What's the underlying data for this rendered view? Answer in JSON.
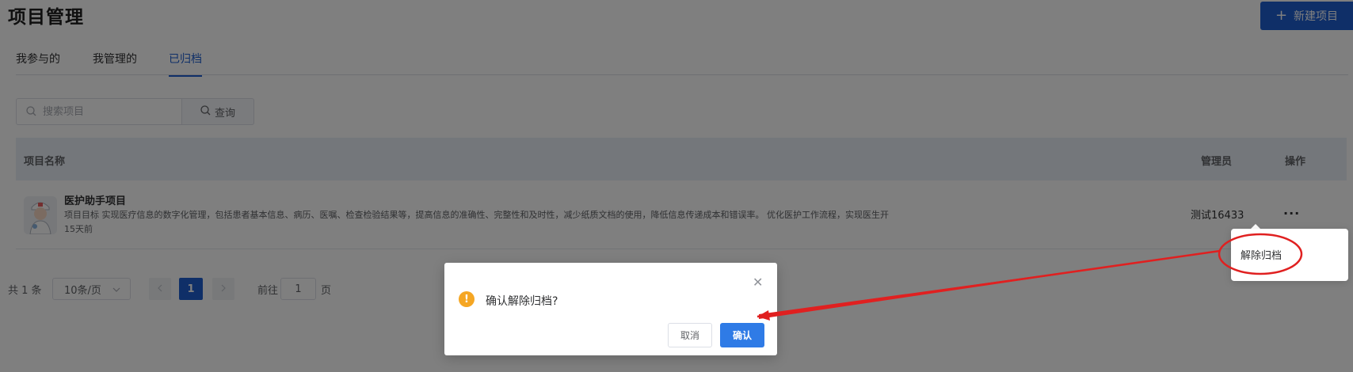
{
  "header": {
    "title": "项目管理",
    "new_button_label": "新建项目"
  },
  "tabs": [
    {
      "label": "我参与的",
      "active": false
    },
    {
      "label": "我管理的",
      "active": false
    },
    {
      "label": "已归档",
      "active": true
    }
  ],
  "search": {
    "placeholder": "搜索项目",
    "value": "",
    "button_label": "查询"
  },
  "table": {
    "columns": [
      "项目名称",
      "管理员",
      "操作"
    ],
    "rows": [
      {
        "name": "医护助手项目",
        "description": "项目目标 实现医疗信息的数字化管理，包括患者基本信息、病历、医嘱、检查检验结果等，提高信息的准确性、完整性和及时性，减少纸质文档的使用，降低信息传递成本和错误率。 优化医护工作流程，实现医生开",
        "time": "15天前",
        "admin": "测试16433",
        "more": "···"
      }
    ]
  },
  "pagination": {
    "total_text": "共 1 条",
    "page_size": "10条/页",
    "current_page": "1",
    "goto_label": "前往",
    "goto_value": "1",
    "unit_label": "页"
  },
  "dropdown": {
    "item_label": "解除归档"
  },
  "dialog": {
    "message": "确认解除归档?",
    "cancel_label": "取消",
    "confirm_label": "确认",
    "icon": "warning-icon"
  },
  "colors": {
    "primary": "#1f5fd1",
    "confirm": "#2f7be6",
    "warning": "#f5a623",
    "annotation": "#e02020"
  }
}
